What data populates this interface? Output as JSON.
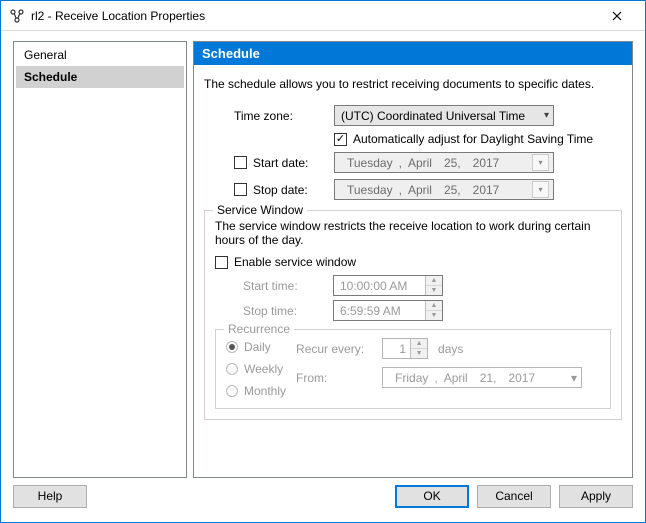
{
  "window": {
    "title": "rl2 - Receive Location Properties"
  },
  "sidebar": {
    "items": [
      {
        "label": "General"
      },
      {
        "label": "Schedule"
      }
    ],
    "selected_index": 1
  },
  "panel": {
    "header": "Schedule",
    "description": "The schedule allows you to restrict receiving documents to specific dates.",
    "timezone": {
      "label": "Time zone:",
      "value": "(UTC) Coordinated Universal Time"
    },
    "dst": {
      "label": "Automatically adjust for Daylight Saving Time",
      "checked": true
    },
    "start_date": {
      "label": "Start date:",
      "checked": false,
      "weekday": "Tuesday",
      "month": "April",
      "day": "25,",
      "year": "2017"
    },
    "stop_date": {
      "label": "Stop date:",
      "checked": false,
      "weekday": "Tuesday",
      "month": "April",
      "day": "25,",
      "year": "2017"
    },
    "service_window": {
      "legend": "Service Window",
      "desc": "The service window restricts the receive location to work during certain hours of the day.",
      "enable": {
        "label": "Enable service window",
        "checked": false
      },
      "start_time": {
        "label": "Start time:",
        "value": "10:00:00 AM"
      },
      "stop_time": {
        "label": "Stop time:",
        "value": "6:59:59 AM"
      },
      "recurrence": {
        "legend": "Recurrence",
        "options": [
          "Daily",
          "Weekly",
          "Monthly"
        ],
        "selected": "Daily",
        "recur_label": "Recur every:",
        "recur_value": "1",
        "recur_unit": "days",
        "from_label": "From:",
        "from_weekday": "Friday",
        "from_month": "April",
        "from_day": "21,",
        "from_year": "2017"
      }
    }
  },
  "buttons": {
    "help": "Help",
    "ok": "OK",
    "cancel": "Cancel",
    "apply": "Apply"
  }
}
